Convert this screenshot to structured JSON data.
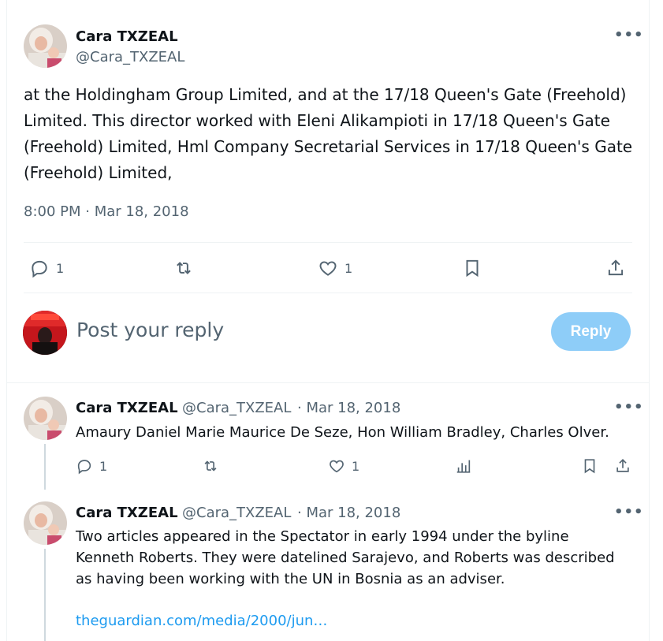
{
  "main_tweet": {
    "author_name": "Cara TXZEAL",
    "author_handle": "@Cara_TXZEAL",
    "more_label": "•••",
    "text": "at the Holdingham  Group Limited,  and at the 17/18 Queen's Gate (Freehold) Limited. This director worked with Eleni Alikampioti in 17/18 Queen's Gate  (Freehold) Limited, Hml Company Secretarial Services in 17/18 Queen's  Gate (Freehold) Limited,",
    "timestamp": "8:00 PM · Mar 18, 2018",
    "reply_count": "1",
    "like_count": "1"
  },
  "composer": {
    "placeholder": "Post your reply",
    "reply_button": "Reply"
  },
  "replies": [
    {
      "author_name": "Cara TXZEAL",
      "author_handle": "@Cara_TXZEAL",
      "date": "· Mar 18, 2018",
      "more_label": "•••",
      "text": "Amaury Daniel Marie Maurice De Seze, Hon  William Bradley, Charles Olver.",
      "reply_count": "1",
      "like_count": "1"
    },
    {
      "author_name": "Cara TXZEAL",
      "author_handle": "@Cara_TXZEAL",
      "date": "· Mar 18, 2018",
      "more_label": "•••",
      "text": "Two articles appeared in the Spectator in early 1994 under the byline Kenneth Roberts. They were datelined Sarajevo, and Roberts was described  as having been working with the UN in Bosnia as an adviser.",
      "link": "theguardian.com/media/2000/jun…"
    }
  ],
  "colors": {
    "text_primary": "#0f1419",
    "text_secondary": "#536471",
    "link": "#1d9bf0",
    "reply_button_bg": "#8ecdf8",
    "divider": "#eff3f4"
  },
  "icons": [
    "reply-icon",
    "repost-icon",
    "like-icon",
    "bookmark-icon",
    "share-icon",
    "analytics-icon",
    "more-icon"
  ]
}
